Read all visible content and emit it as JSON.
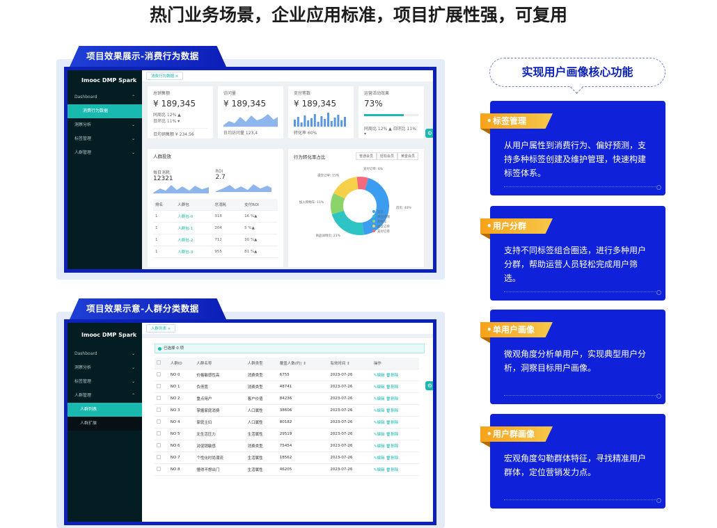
{
  "page_title": "热门业务场景，企业应用标准，项目扩展性强，可复用",
  "panel1": {
    "tab": "项目效果展示-消费行为数据",
    "logo": "Imooc DMP Spark",
    "menu": [
      {
        "label": "Dashboard",
        "arrow": "⌃"
      },
      {
        "label": "消费行为数据",
        "arrow": ""
      },
      {
        "label": "洞察分析",
        "arrow": "⌄"
      },
      {
        "label": "标签管理",
        "arrow": "⌄"
      },
      {
        "label": "人群管理",
        "arrow": "⌄"
      }
    ],
    "page_tab": "消费行为数据 ×",
    "kpis": [
      {
        "title": "总销售额",
        "value": "¥ 189,345",
        "l1": "同周比 12% ▲",
        "l2": "日环比 11% ▾",
        "foot": "日均销售额 ¥ 234.56"
      },
      {
        "title": "访问量",
        "value": "¥ 189,345",
        "foot": "日均访问量 123,4"
      },
      {
        "title": "支付笔数",
        "value": "¥ 189,345",
        "foot": "转化率 60%"
      },
      {
        "title": "运营活动效果",
        "value": "73%",
        "foot": "同周比 12% ▲  日环比 11% ▾",
        "progress": 73
      }
    ],
    "invest": {
      "title": "人群投放",
      "m1_label": "每日消耗",
      "m1_value": "12321",
      "m1_delta": "71.2 ▾",
      "m2_label": "ROI",
      "m2_value": "2.7",
      "m2_delta": "71.2 ▾",
      "headers": [
        "排名",
        "人群包",
        "总消耗",
        "支付ROI"
      ],
      "rows": [
        [
          "1",
          "人群包-0",
          "318",
          "16 %▲"
        ],
        [
          "1",
          "人群包-1",
          "204",
          "5 %▲"
        ],
        [
          "1",
          "人群包-2",
          "712",
          "30 %▲"
        ],
        [
          "1",
          "人群包-3",
          "955",
          "81 %▲"
        ]
      ]
    },
    "conv": {
      "title": "行为转化率占比",
      "btns": [
        "普通会员",
        "轻松会员",
        "黄金会员"
      ],
      "chart_data": {
        "type": "pie",
        "labels": [
          "首页",
          "加入购物车",
          "提交订单",
          "支付订单",
          "商品详情页"
        ],
        "values": [
          40,
          11,
          15,
          6,
          21
        ],
        "legend": [
          "首页",
          "商品详情",
          "购物车",
          "提交订单",
          "支付订单"
        ],
        "annotations": [
          "首页: 40%",
          "加入购物车: 11%",
          "提交订单: 15%",
          "支付订单: 6%",
          "商品详情页: 21%"
        ]
      }
    }
  },
  "panel2": {
    "tab": "项目效果示意-人群分类数据",
    "logo": "Imooc DMP Spark",
    "menu": [
      {
        "label": "Dashboard",
        "arrow": "⌄"
      },
      {
        "label": "洞察分析",
        "arrow": "⌄"
      },
      {
        "label": "标签管理",
        "arrow": "⌄"
      },
      {
        "label": "人群管理",
        "arrow": "⌃"
      },
      {
        "label": "人群列表",
        "arrow": ""
      },
      {
        "label": "人群扩展",
        "arrow": ""
      }
    ],
    "page_tab": "人群列表 ×",
    "selected": "已选择 0 项",
    "headers": [
      "人群ID",
      "人群名称",
      "人群类型",
      "覆盖人数(约) ⇕",
      "有效时间 ⇕",
      "操作"
    ],
    "edit": "✎编辑",
    "del": "🗑删除",
    "rows": [
      [
        "NO 0",
        "价格敏感性高",
        "消费类型",
        "6755",
        "2023-07-26"
      ],
      [
        "NO 1",
        "负债宽",
        "消费类型",
        "48741",
        "2023-07-26"
      ],
      [
        "NO 2",
        "重点用户",
        "客户价值",
        "84236",
        "2023-07-26"
      ],
      [
        "NO 3",
        "掌握家庭消费",
        "人口属性",
        "38606",
        "2023-07-26"
      ],
      [
        "NO 4",
        "家庭主妇",
        "人口属性",
        "80182",
        "2023-07-26"
      ],
      [
        "NO 5",
        "无生活压力",
        "生活属性",
        "29519",
        "2023-07-26"
      ],
      [
        "NO 6",
        "对促销敏感",
        "消费类型",
        "75454",
        "2023-07-26"
      ],
      [
        "NO 7",
        "个性化时尚潮流",
        "生活属性",
        "18562",
        "2023-07-26"
      ],
      [
        "NO 8",
        "懂得不想出门",
        "生活属性",
        "46205",
        "2023-07-26"
      ]
    ]
  },
  "features": {
    "heading": "实现用户画像核心功能",
    "cards": [
      {
        "title": "标签管理",
        "text": "从用户属性到消费行为、偏好预测，支持多种标签创建及维护管理，快速构建标签体系。"
      },
      {
        "title": "用户分群",
        "text": "支持不同标签组合圈选，进行多种用户分群，帮助运营人员轻松完成用户筛选。"
      },
      {
        "title": "单用户画像",
        "text": "微观角度分析单用户，实现典型用户分析，洞察目标用户画像。"
      },
      {
        "title": "用户群画像",
        "text": "宏观角度勾勒群体特征，寻找精准用户群体，定位营销发力点。"
      }
    ]
  },
  "colors": {
    "accent": "#19b9b0",
    "brand": "#0b21b8",
    "badge": "#f7a21b"
  }
}
